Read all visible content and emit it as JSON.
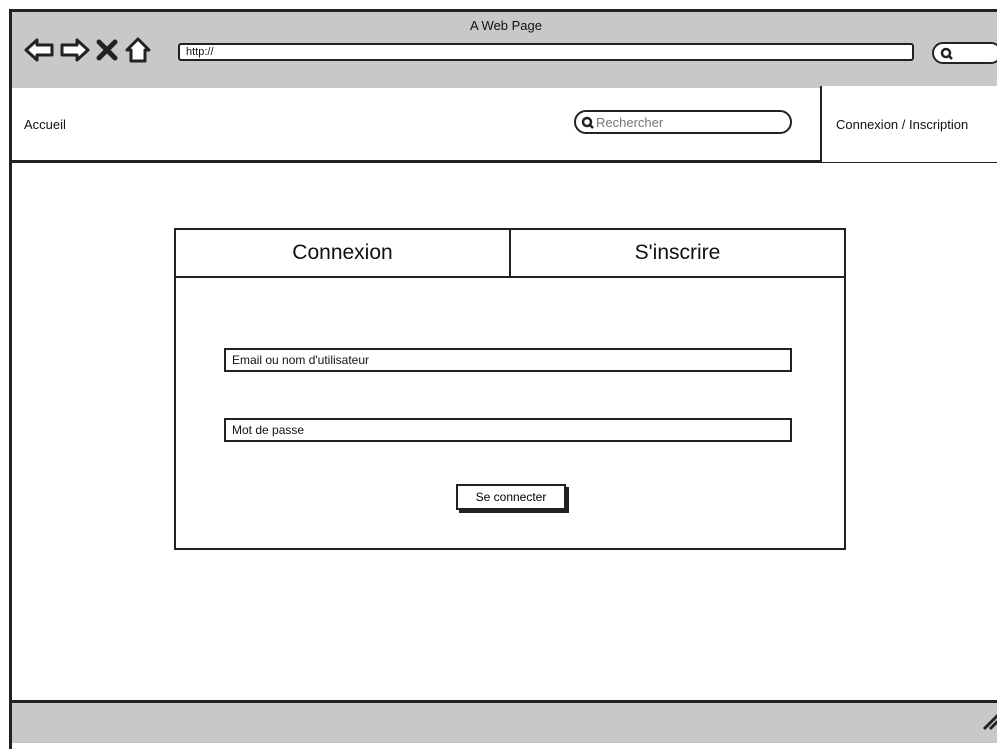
{
  "browser": {
    "title": "A Web Page",
    "url": "http://"
  },
  "header": {
    "home_link": "Accueil",
    "search_placeholder": "Rechercher",
    "auth_link": "Connexion / Inscription"
  },
  "login_card": {
    "tabs": [
      {
        "label": "Connexion"
      },
      {
        "label": "S'inscrire"
      }
    ],
    "email_placeholder": "Email ou nom d'utilisateur",
    "password_placeholder": "Mot de passe",
    "submit_label": "Se connecter"
  }
}
